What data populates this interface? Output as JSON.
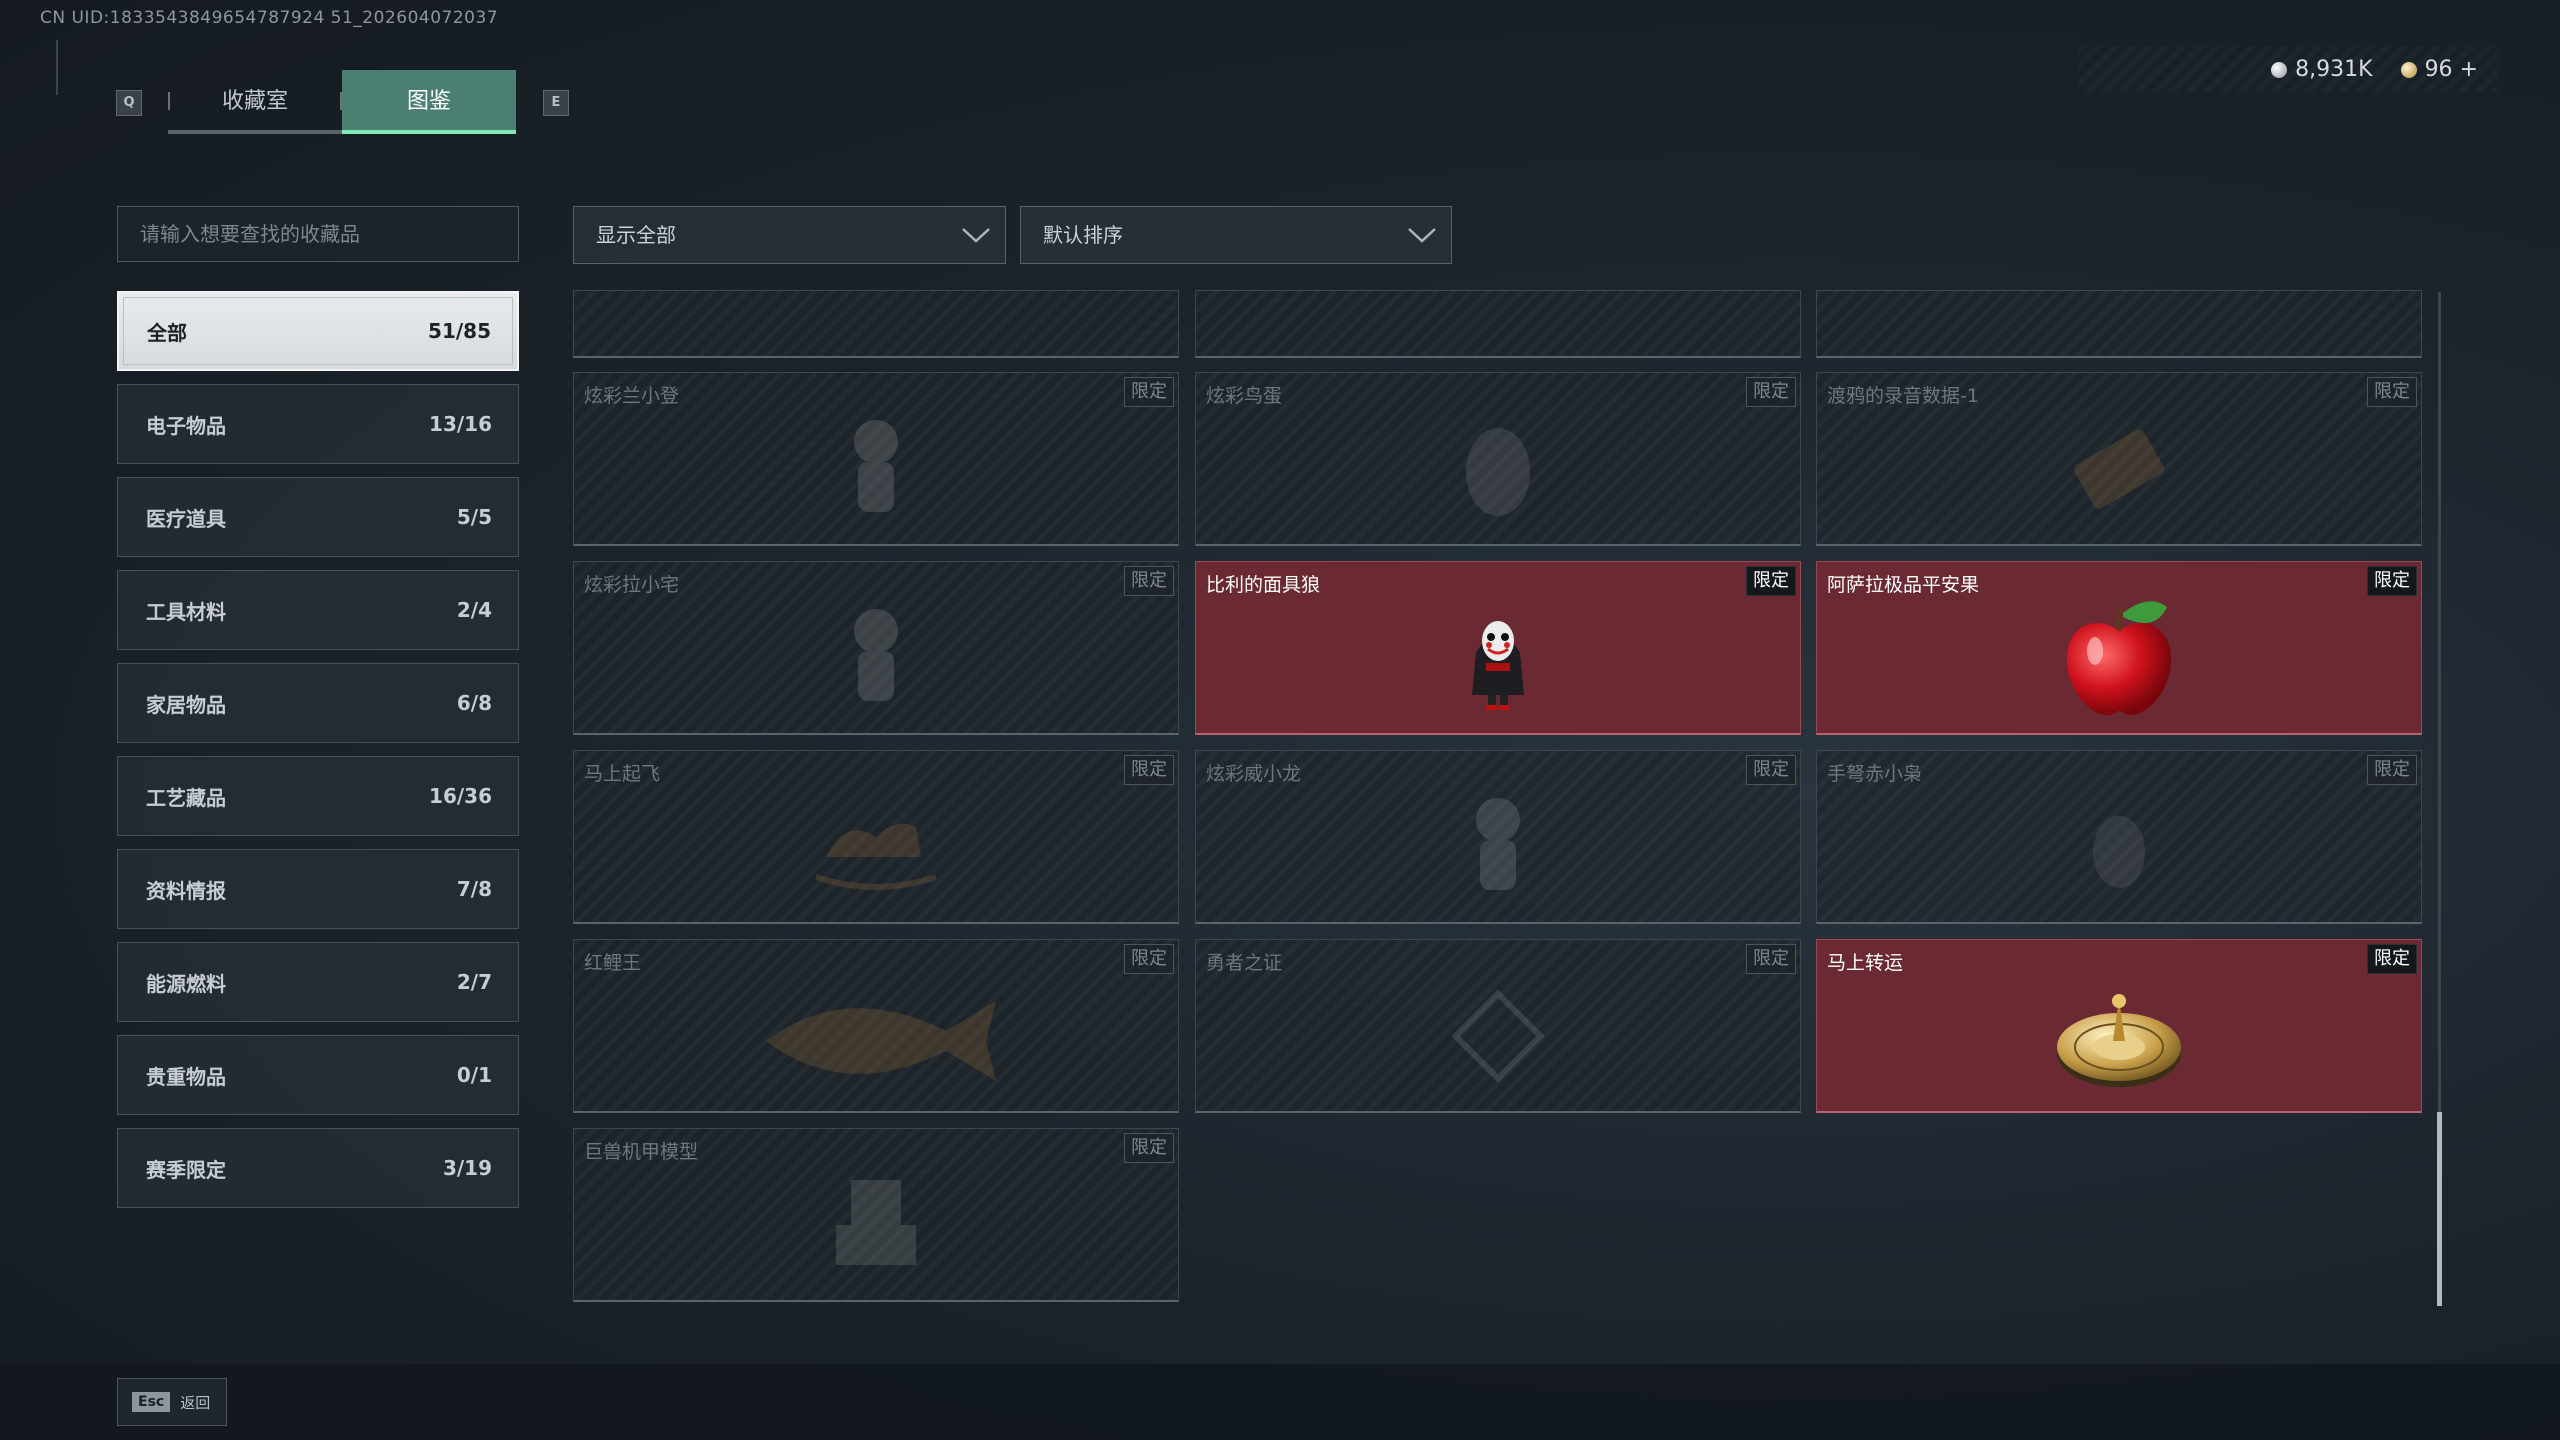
{
  "header": {
    "uid": "CN UID:1833543849654787924 51_202604072037",
    "key_q": "Q",
    "key_e": "E",
    "tabs": [
      {
        "label": "收藏室",
        "active": false
      },
      {
        "label": "图鉴",
        "active": true
      }
    ],
    "currency": [
      {
        "icon": "silver-coin-icon",
        "value": "8,931K"
      },
      {
        "icon": "gold-coin-icon",
        "value": "96"
      }
    ],
    "add_label": "+"
  },
  "filters": {
    "search_placeholder": "请输入想要查找的收藏品",
    "show": "显示全部",
    "sort": "默认排序"
  },
  "categories": [
    {
      "label": "全部",
      "count": "51/85",
      "active": true
    },
    {
      "label": "电子物品",
      "count": "13/16"
    },
    {
      "label": "医疗道具",
      "count": "5/5"
    },
    {
      "label": "工具材料",
      "count": "2/4"
    },
    {
      "label": "家居物品",
      "count": "6/8"
    },
    {
      "label": "工艺藏品",
      "count": "16/36"
    },
    {
      "label": "资料情报",
      "count": "7/8"
    },
    {
      "label": "能源燃料",
      "count": "2/7"
    },
    {
      "label": "贵重物品",
      "count": "0/1"
    },
    {
      "label": "赛季限定",
      "count": "3/19"
    }
  ],
  "badge_label": "限定",
  "items": [
    {
      "name": "炫彩兰小登",
      "owned": false,
      "icon": "figure-icon"
    },
    {
      "name": "炫彩鸟蛋",
      "owned": false,
      "icon": "egg-icon"
    },
    {
      "name": "渡鸦的录音数据-1",
      "owned": false,
      "icon": "data-chip-icon"
    },
    {
      "name": "炫彩拉小宅",
      "owned": false,
      "icon": "figure-icon"
    },
    {
      "name": "比利的面具狼",
      "owned": true,
      "icon": "mask-figure-icon"
    },
    {
      "name": "阿萨拉极品平安果",
      "owned": true,
      "icon": "apple-icon"
    },
    {
      "name": "马上起飞",
      "owned": false,
      "icon": "rocking-horse-icon"
    },
    {
      "name": "炫彩威小龙",
      "owned": false,
      "icon": "figure-icon"
    },
    {
      "name": "手弩赤小枭",
      "owned": false,
      "icon": "owl-icon"
    },
    {
      "name": "红鲤王",
      "owned": false,
      "icon": "fish-icon"
    },
    {
      "name": "勇者之证",
      "owned": false,
      "icon": "badge-icon"
    },
    {
      "name": "马上转运",
      "owned": true,
      "icon": "roulette-icon"
    },
    {
      "name": "巨兽机甲模型",
      "owned": false,
      "icon": "mech-icon"
    }
  ],
  "footer": {
    "esc_key": "Esc",
    "back_label": "返回"
  }
}
